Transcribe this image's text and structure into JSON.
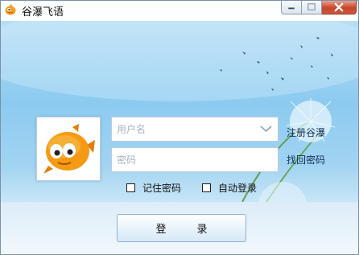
{
  "window": {
    "title": "谷瀑飞语",
    "controls": [
      "minimize",
      "maximize",
      "close"
    ]
  },
  "login": {
    "username_placeholder": "用户名",
    "password_placeholder": "密码",
    "register_link": "注册谷瀑",
    "forgot_link": "找回密码",
    "remember_label": "记住密码",
    "auto_login_label": "自动登录",
    "remember_checked": false,
    "auto_login_checked": false,
    "button_label": "登录"
  },
  "icons": {
    "app": "goldfish-icon",
    "avatar": "goldfish-avatar",
    "dropdown": "chevron-down-icon"
  },
  "colors": {
    "accent": "#8ccaf0",
    "close_button": "#c7442c",
    "link_text": "#0f2f54"
  }
}
